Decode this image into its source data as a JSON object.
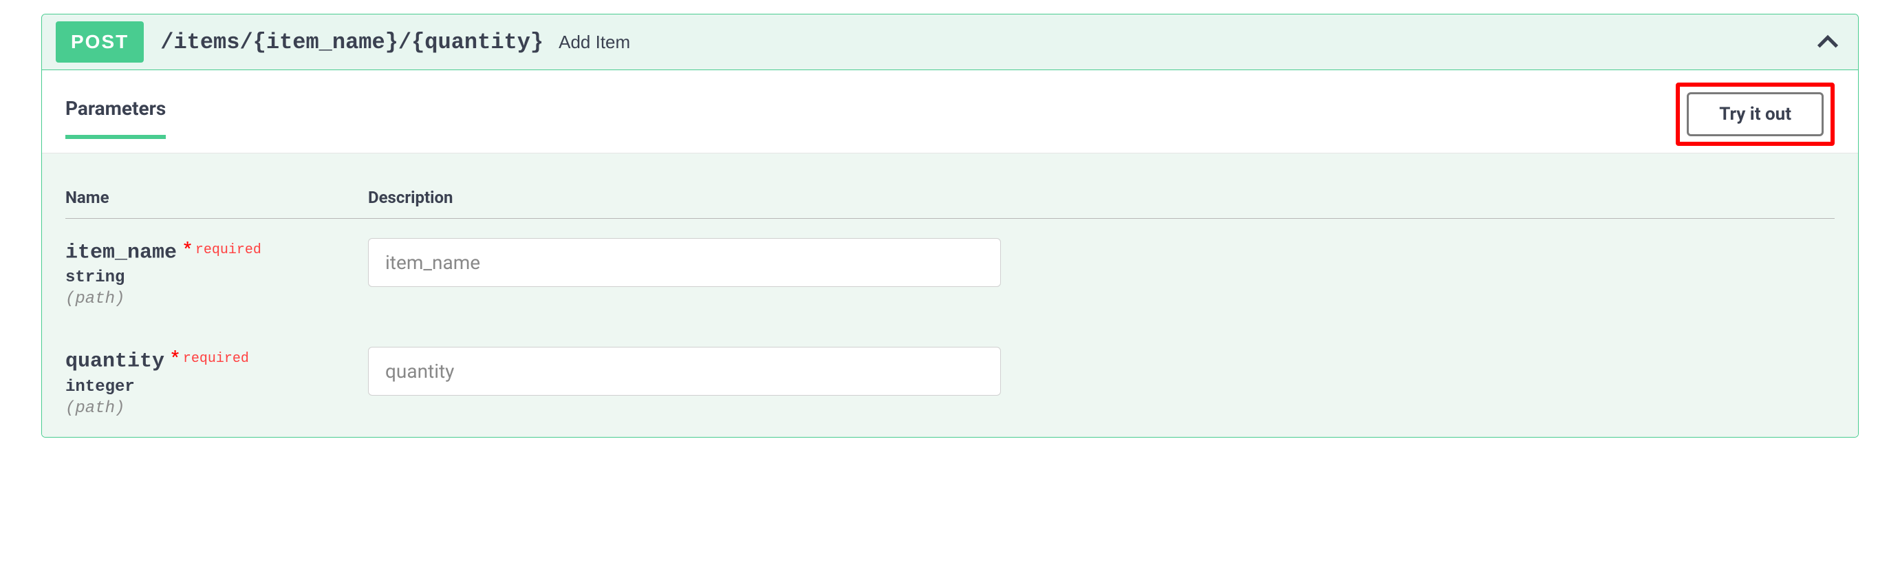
{
  "operation": {
    "method": "POST",
    "path": "/items/{item_name}/{quantity}",
    "summary": "Add Item"
  },
  "section": {
    "parameters_label": "Parameters",
    "try_it_out_label": "Try it out"
  },
  "table": {
    "name_header": "Name",
    "description_header": "Description"
  },
  "params": [
    {
      "name": "item_name",
      "required_star": "*",
      "required_text": "required",
      "type": "string",
      "in": "(path)",
      "placeholder": "item_name"
    },
    {
      "name": "quantity",
      "required_star": "*",
      "required_text": "required",
      "type": "integer",
      "in": "(path)",
      "placeholder": "quantity"
    }
  ]
}
